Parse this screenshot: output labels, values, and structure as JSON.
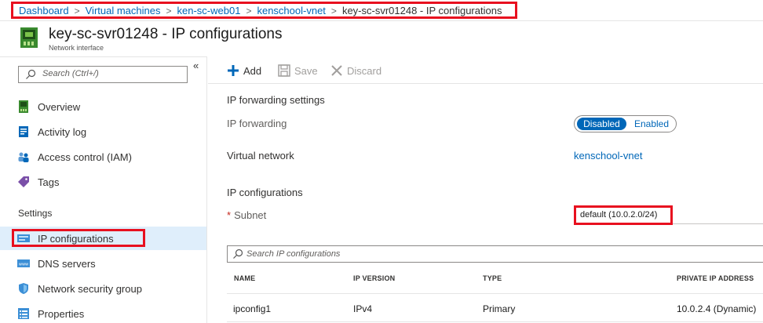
{
  "breadcrumb": {
    "items": [
      "Dashboard",
      "Virtual machines",
      "ken-sc-web01",
      "kenschool-vnet"
    ],
    "current": "key-sc-svr01248 - IP configurations",
    "separator": ">"
  },
  "header": {
    "title": "key-sc-svr01248 - IP configurations",
    "subtitle": "Network interface"
  },
  "sidebar": {
    "collapse_glyph": "«",
    "search_placeholder": "Search (Ctrl+/)",
    "items": [
      {
        "label": "Overview",
        "icon": "network-interface-icon"
      },
      {
        "label": "Activity log",
        "icon": "activity-log-icon"
      },
      {
        "label": "Access control (IAM)",
        "icon": "people-icon"
      },
      {
        "label": "Tags",
        "icon": "tag-icon"
      }
    ],
    "section_label": "Settings",
    "settings_items": [
      {
        "label": "IP configurations",
        "icon": "ip-config-icon",
        "selected": true
      },
      {
        "label": "DNS servers",
        "icon": "dns-icon"
      },
      {
        "label": "Network security group",
        "icon": "shield-icon"
      },
      {
        "label": "Properties",
        "icon": "properties-icon"
      }
    ]
  },
  "toolbar": {
    "add_label": "Add",
    "save_label": "Save",
    "discard_label": "Discard"
  },
  "content": {
    "forwarding_section": "IP forwarding settings",
    "forwarding_label": "IP forwarding",
    "toggle": {
      "on_label": "Disabled",
      "off_label": "Enabled",
      "selected": "Disabled"
    },
    "vnet_label": "Virtual network",
    "vnet_value": "kenschool-vnet",
    "ipconfig_section": "IP configurations",
    "subnet_required": "*",
    "subnet_label": "Subnet",
    "subnet_value": "default (10.0.2.0/24)",
    "search_placeholder": "Search IP configurations"
  },
  "table": {
    "columns": [
      "NAME",
      "IP VERSION",
      "TYPE",
      "PRIVATE IP ADDRESS"
    ],
    "rows": [
      [
        "ipconfig1",
        "IPv4",
        "Primary",
        "10.0.2.4 (Dynamic)"
      ]
    ]
  },
  "colors": {
    "accent": "#0067b8",
    "highlight_box": "#e8101f",
    "selected_bg": "#dfeefb"
  }
}
